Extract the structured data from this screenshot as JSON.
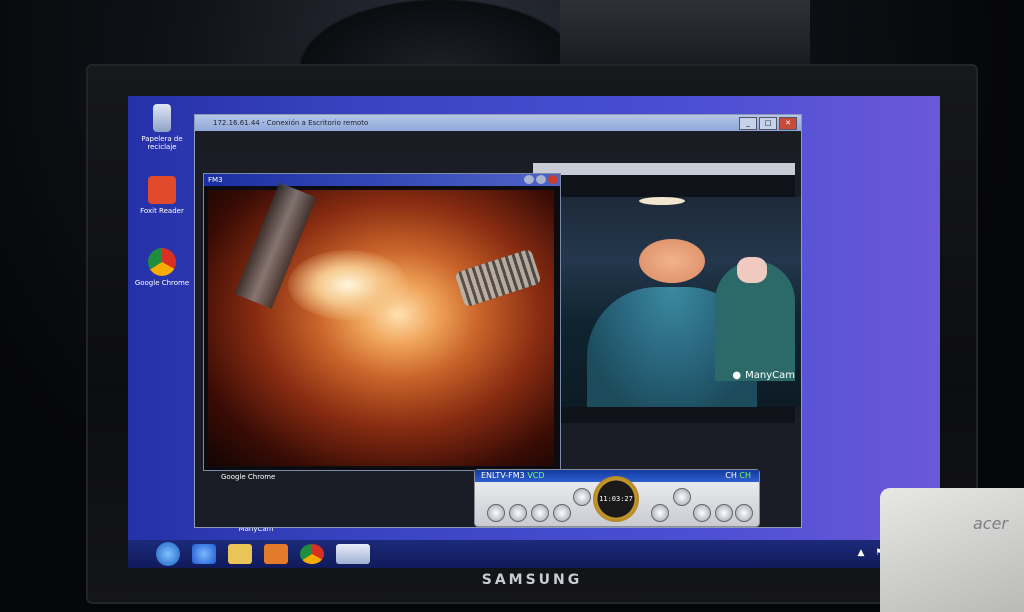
{
  "scene": {
    "monitor_brand": "SAMSUNG",
    "laptop_brand": "acer"
  },
  "desktop": {
    "icons": [
      {
        "label": "Papelera de reciclaje",
        "icon": "recycle-bin-icon"
      },
      {
        "label": "Foxit Reader",
        "icon": "foxit-reader-icon"
      },
      {
        "label": "Google Chrome",
        "icon": "chrome-icon"
      },
      {
        "label": "ManyCam",
        "icon": "manycam-icon"
      }
    ]
  },
  "main_window": {
    "title": "172.16.61.44 - Conexión a Escritorio remoto"
  },
  "fm3_window": {
    "title": "FM3",
    "taskbar_label": "Google Chrome"
  },
  "camera": {
    "watermark": "ManyCam"
  },
  "player": {
    "title": "ENLTV-FM3",
    "mode": "VCD",
    "channel_a": "CH",
    "channel_b": "CH",
    "time": "11:03:27"
  },
  "colors": {
    "desktop_blue": "#3a44c2",
    "taskbar": "#101a5a",
    "player_title": "#2f5fd0"
  }
}
